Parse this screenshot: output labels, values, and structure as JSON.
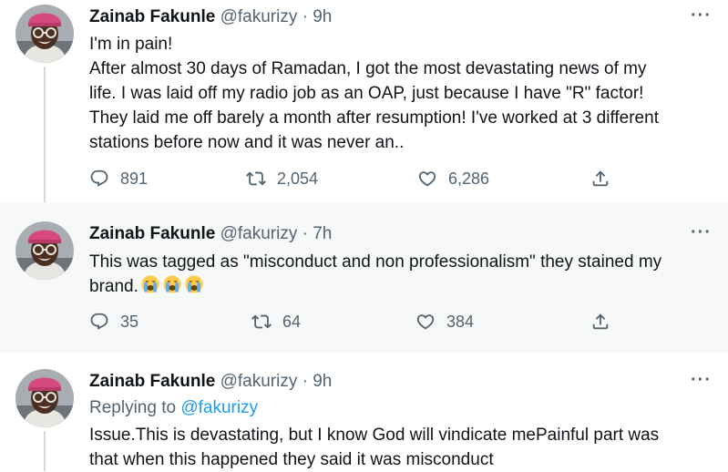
{
  "tweets": [
    {
      "name": "Zainab Fakunle",
      "handle": "@fakurizy",
      "time": "9h",
      "more": "···",
      "lines": [
        "I'm in pain!",
        "After almost 30 days of Ramadan, I got the most devastating news of my",
        "life. I was laid off my radio job as an OAP,  just because I have \"R\" factor!",
        "They laid me off barely a month after resumption! I've worked at 3 different",
        "stations before now and it was never an.."
      ],
      "replies": "891",
      "retweets": "2,054",
      "likes": "6,286"
    },
    {
      "name": "Zainab Fakunle",
      "handle": "@fakurizy",
      "time": "7h",
      "more": "···",
      "lines": [
        "This was tagged as \"misconduct and non professionalism\" they stained my",
        "brand."
      ],
      "emoji": [
        "crying-face",
        "crying-face",
        "crying-face"
      ],
      "replies": "35",
      "retweets": "64",
      "likes": "384"
    },
    {
      "name": "Zainab Fakunle",
      "handle": "@fakurizy",
      "time": "9h",
      "more": "···",
      "replying_to_label": "Replying to",
      "replying_to_handle": "@fakurizy",
      "lines": [
        "Issue.This is devastating, but I know God will vindicate mePainful part was",
        "that when this happened they said it was misconduct"
      ]
    }
  ],
  "colors": {
    "text": "#0f1419",
    "secondary": "#536471",
    "link": "#1d9bf0",
    "highlight_bg": "#f7f9f9",
    "thread_line": "#cfd9de"
  },
  "icons": [
    "reply-icon",
    "retweet-icon",
    "like-icon",
    "share-icon",
    "more-icon"
  ]
}
